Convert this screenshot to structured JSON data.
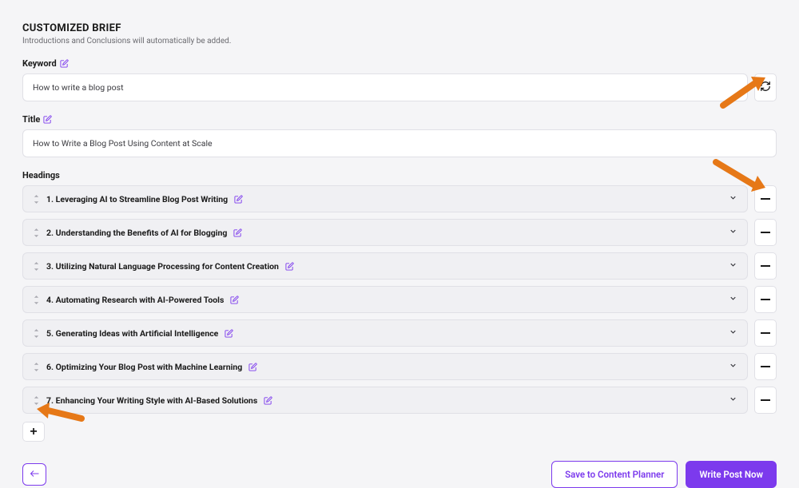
{
  "section": {
    "title": "CUSTOMIZED BRIEF",
    "subtitle": "Introductions and Conclusions will automatically be added."
  },
  "keyword": {
    "label": "Keyword",
    "value": "How to write a blog post"
  },
  "title": {
    "label": "Title",
    "value": "How to Write a Blog Post Using Content at Scale"
  },
  "headings": {
    "label": "Headings",
    "items": [
      {
        "text": "1. Leveraging AI to Streamline Blog Post Writing"
      },
      {
        "text": "2. Understanding the Benefits of AI for Blogging"
      },
      {
        "text": "3. Utilizing Natural Language Processing for Content Creation"
      },
      {
        "text": "4. Automating Research with AI-Powered Tools"
      },
      {
        "text": "5. Generating Ideas with Artificial Intelligence"
      },
      {
        "text": "6. Optimizing Your Blog Post with Machine Learning"
      },
      {
        "text": "7. Enhancing Your Writing Style with AI-Based Solutions"
      }
    ]
  },
  "footer": {
    "save_label": "Save to Content Planner",
    "write_label": "Write Post Now"
  }
}
